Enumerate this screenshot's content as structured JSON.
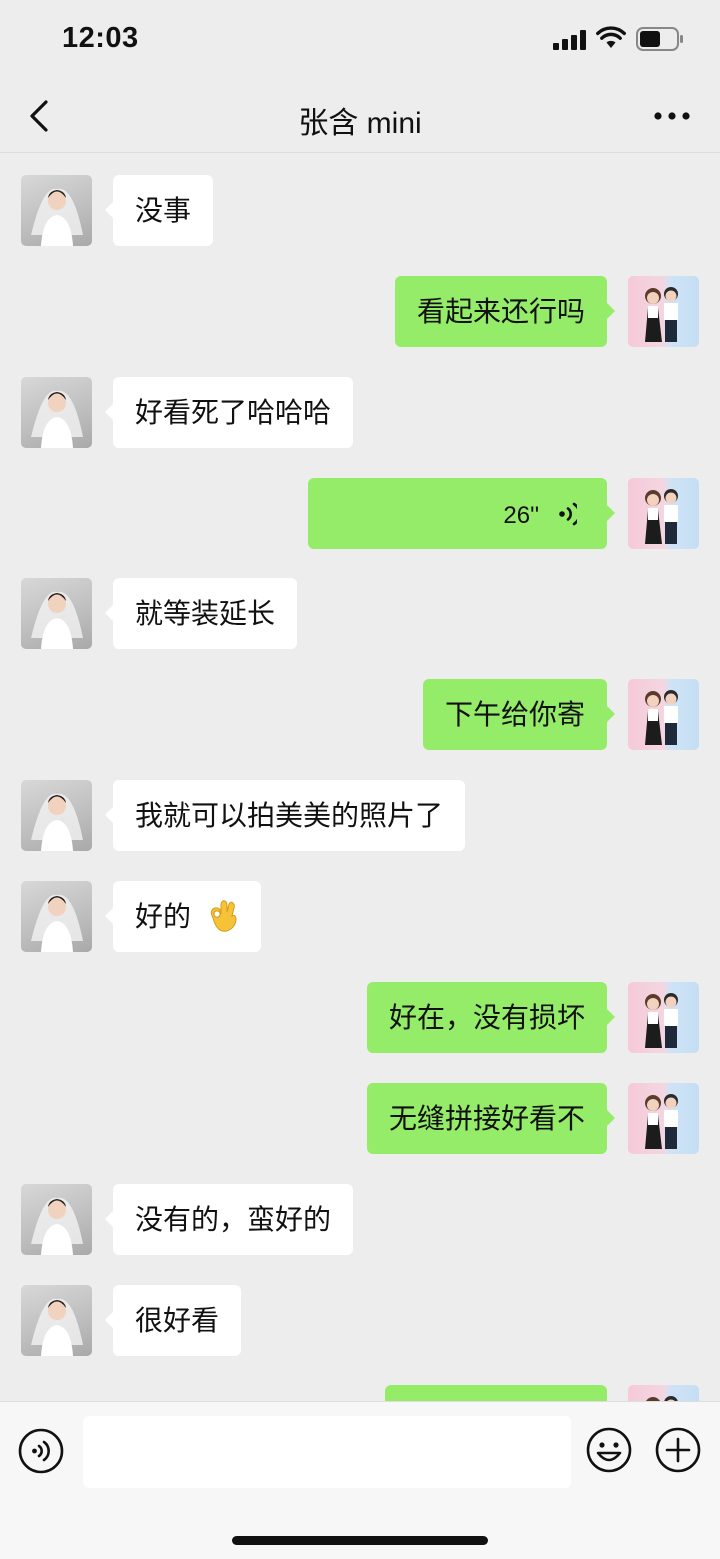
{
  "status_bar": {
    "time": "12:03"
  },
  "header": {
    "title": "张含 mini"
  },
  "icons": {
    "back": "chevron-left-icon",
    "more": "ellipsis-icon",
    "voice_input": "voice-input-icon",
    "emoji": "smiley-icon",
    "plus": "plus-icon"
  },
  "colors": {
    "sent_bubble": "#95ec69",
    "received_bubble": "#ffffff",
    "background": "#ededed"
  },
  "messages": [
    {
      "side": "left",
      "text": "没事"
    },
    {
      "side": "right",
      "text": "看起来还行吗"
    },
    {
      "side": "left",
      "text": "好看死了哈哈哈"
    },
    {
      "side": "right",
      "type": "voice",
      "duration": "26''"
    },
    {
      "side": "left",
      "text": "就等装延长"
    },
    {
      "side": "right",
      "text": "下午给你寄"
    },
    {
      "side": "left",
      "text": "我就可以拍美美的照片了"
    },
    {
      "side": "left",
      "text": "好的",
      "emoji": "ok-hand"
    },
    {
      "side": "right",
      "text": "好在，没有损坏"
    },
    {
      "side": "right",
      "text": "无缝拼接好看不"
    },
    {
      "side": "left",
      "text": "没有的，蛮好的"
    },
    {
      "side": "left",
      "text": "很好看"
    }
  ],
  "input": {
    "value": ""
  }
}
